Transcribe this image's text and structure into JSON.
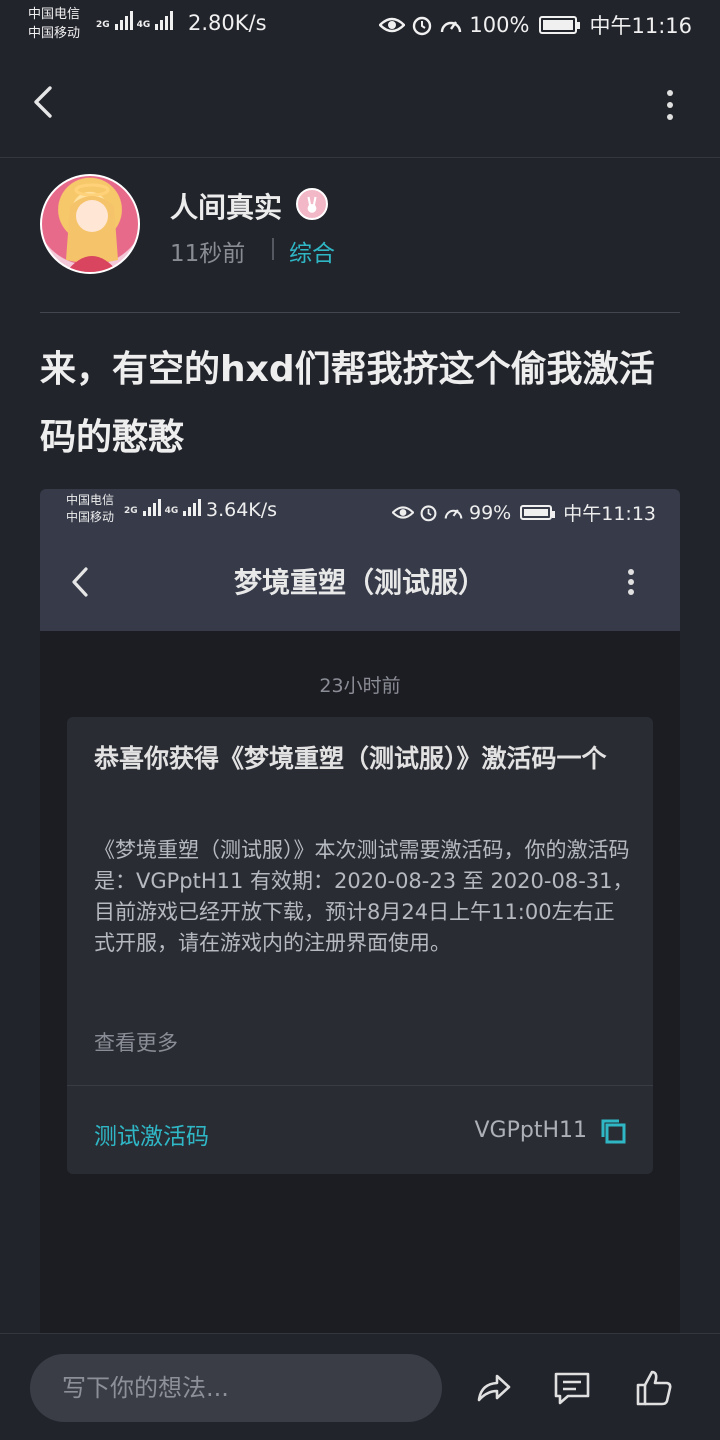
{
  "status_bar": {
    "carrier_1": "中国电信",
    "carrier_2": "中国移动",
    "net_1": "2G",
    "net_2": "4G",
    "speed": "2.80K/s",
    "battery": "100%",
    "time": "中午11:16"
  },
  "author": {
    "name": "人间真实",
    "time": "11秒前",
    "category": "综合"
  },
  "post": {
    "title": "来，有空的hxd们帮我挤这个偷我激活码的憨憨"
  },
  "screenshot": {
    "status_bar": {
      "carrier_1": "中国电信",
      "carrier_2": "中国移动",
      "net_1": "2G",
      "net_2": "4G",
      "speed": "3.64K/s",
      "battery": "99%",
      "time": "中午11:13"
    },
    "title": "梦境重塑（测试服）",
    "timestamp": "23小时前",
    "card": {
      "title": "恭喜你获得《梦境重塑（测试服）》激活码一个",
      "body": "《梦境重塑（测试服）》本次测试需要激活码，你的激活码是：VGPptH11 有效期：2020-08-23 至 2020-08-31，目前游戏已经开放下载，预计8月24日上午11:00左右正式开服，请在游戏内的注册界面使用。",
      "more": "查看更多",
      "code_label": "测试激活码",
      "code_value": "VGPptH11"
    }
  },
  "bottom_bar": {
    "placeholder": "写下你的想法..."
  },
  "icons": [
    "back-icon",
    "more-icon",
    "eye-icon",
    "alarm-icon",
    "speedometer-icon",
    "battery-icon",
    "copy-icon",
    "share-icon",
    "comment-icon",
    "like-icon"
  ],
  "colors": {
    "background": "#22242c",
    "accent": "#2fb7c6",
    "screenshot_header": "#363a49",
    "card": "#2a2c34"
  }
}
